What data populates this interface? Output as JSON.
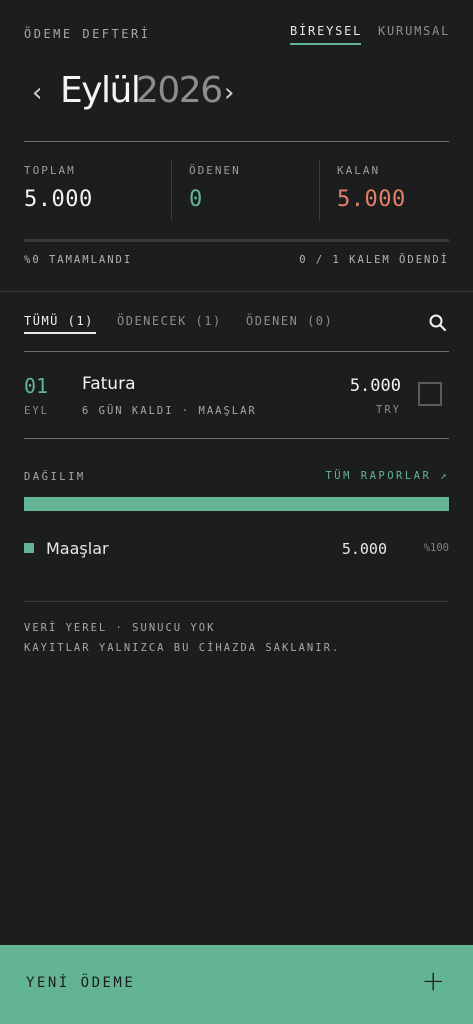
{
  "header": {
    "title": "ÖDEME DEFTERİ",
    "segments": [
      "BİREYSEL",
      "KURUMSAL"
    ]
  },
  "period": {
    "month": "Eylül",
    "year": "2026",
    "prev_icon": "chevron-left-icon",
    "next_icon": "chevron-right-icon"
  },
  "summary": {
    "total_label": "TOPLAM",
    "total_value": "5.000",
    "paid_label": "ÖDENEN",
    "paid_value": "0",
    "remaining_label": "KALAN",
    "remaining_value": "5.000",
    "progress_fraction": 0,
    "progress_text": "%0 TAMAMLANDI",
    "items_text": "0 / 1 KALEM ÖDENDİ"
  },
  "tabs": [
    {
      "label": "TÜMÜ (1)"
    },
    {
      "label": "ÖDENECEK (1)"
    },
    {
      "label": "ÖDENEN (0)"
    }
  ],
  "search_icon": "search-icon",
  "items": [
    {
      "day": "01",
      "month": "EYL",
      "title": "Fatura",
      "subtitle": "6 GÜN KALDI · MAAŞLAR",
      "amount": "5.000",
      "currency": "TRY",
      "checked": false
    }
  ],
  "distribution": {
    "label": "DAĞILIM",
    "reports_link": "TÜM RAPORLAR ↗",
    "entries": [
      {
        "name": "Maaşlar",
        "amount": "5.000",
        "percent": "%100",
        "fraction": 1.0
      }
    ]
  },
  "info": {
    "line1": "VERİ YEREL · SUNUCU YOK",
    "line2": "KAYITLAR YALNIZCA BU CİHAZDA SAKLANIR."
  },
  "footer": {
    "label": "YENİ ÖDEME",
    "plus": "+"
  },
  "colors": {
    "background": "#1c1d1d",
    "accent": "#62b495",
    "remaining": "#e0806a"
  }
}
